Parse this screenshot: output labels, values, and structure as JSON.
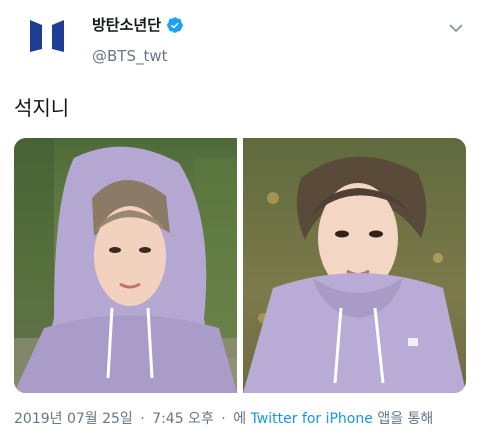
{
  "user": {
    "display_name": "방탄소년단",
    "handle": "@BTS_twt",
    "verified": true,
    "avatar_logo_text": "BTS",
    "avatar_color": "#1e3e93"
  },
  "tweet": {
    "text": "석지니"
  },
  "media": [
    {
      "alt_name": "selfie-photo-1",
      "hoodie_color": "#b4a8d2"
    },
    {
      "alt_name": "selfie-photo-2",
      "hoodie_color": "#b8acd6"
    }
  ],
  "meta": {
    "date": "2019년 07월 25일",
    "separator": "·",
    "time": "7:45 오후",
    "via_prefix": "에",
    "source": "Twitter for iPhone",
    "via_suffix": "앱을 통해"
  },
  "colors": {
    "link": "#1b95e0",
    "verified_badge": "#1da1f2",
    "secondary_text": "#657786"
  }
}
